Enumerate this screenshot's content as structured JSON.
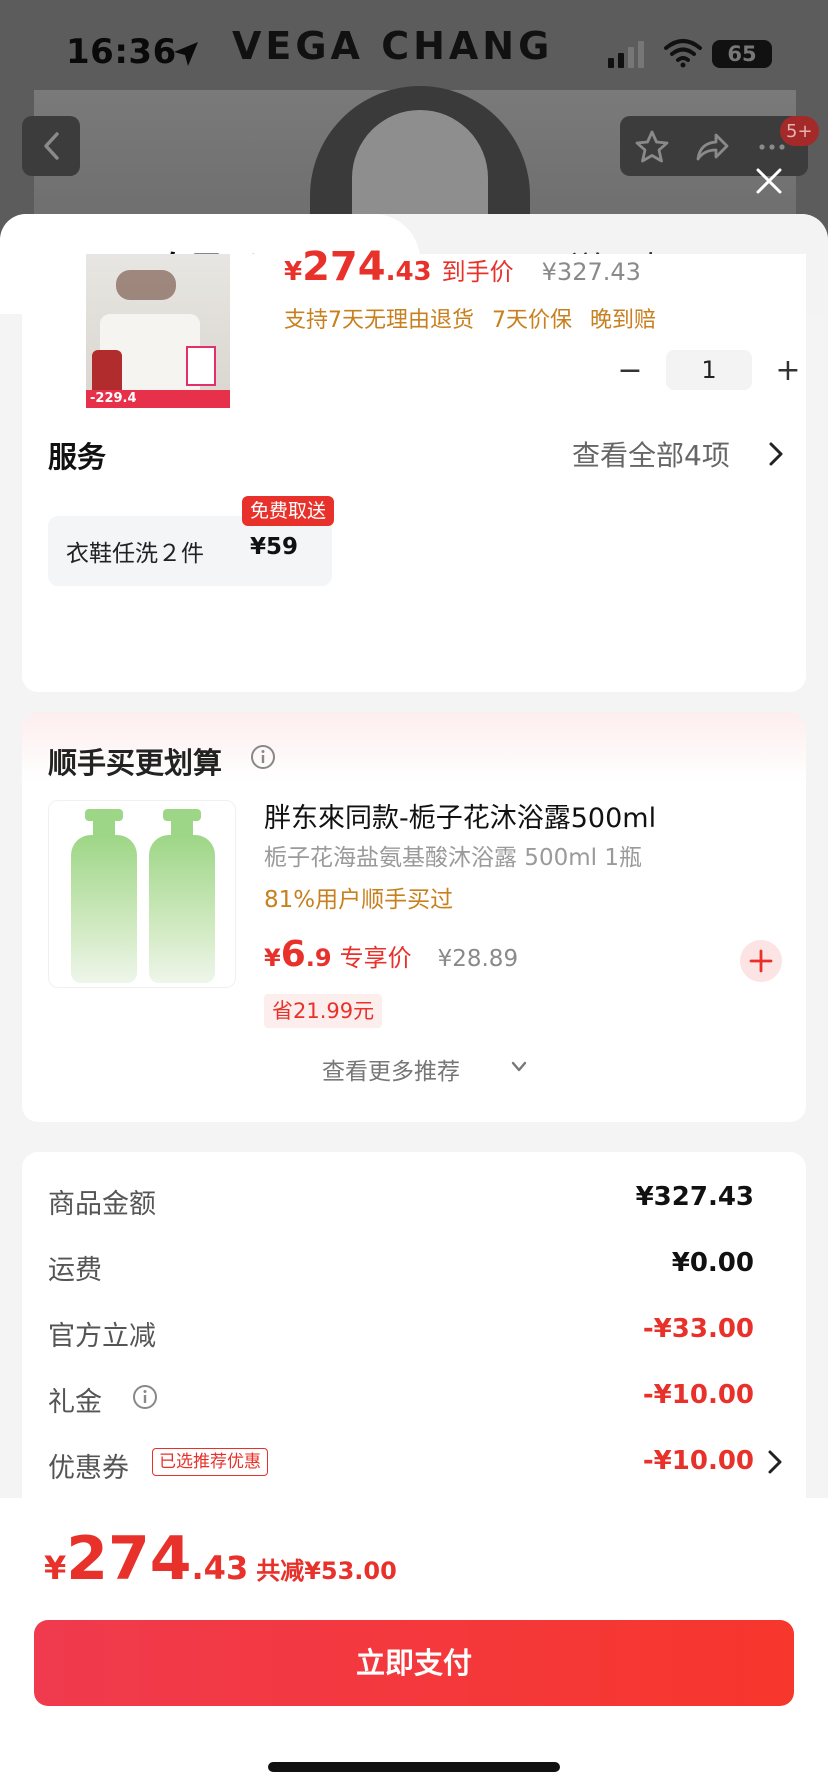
{
  "status_bar": {
    "time": "16:36",
    "carrier": "VEGA CHANG",
    "battery": "65"
  },
  "header": {
    "message_badge": "5+"
  },
  "tabs": [
    {
      "label": "自己买",
      "active": true
    },
    {
      "label": "送朋友",
      "active": false
    }
  ],
  "product": {
    "price_currency": "¥",
    "price_integer": "274",
    "price_decimal": ".43",
    "price_tag": "到手价",
    "original_price": "¥327.43",
    "guarantees": [
      "支持7天无理由退货",
      "7天价保",
      "晚到赔"
    ],
    "image_price_label": "-229.4",
    "quantity": "1"
  },
  "service": {
    "title": "服务",
    "view_all": "查看全部4项",
    "item_name": "衣鞋任洗２件",
    "item_price": "¥59",
    "item_badge": "免费取送"
  },
  "addon": {
    "title": "顺手买更划算",
    "name": "胖东來同款-栀子花沐浴露500ml",
    "spec": "栀子花海盐氨基酸沐浴露 500ml 1瓶",
    "social_proof": "81%用户顺手买过",
    "price_currency": "¥",
    "price_integer": "6",
    "price_decimal": ".9",
    "price_tag": "专享价",
    "original_price": "¥28.89",
    "save_label": "省21.99元",
    "more_label": "查看更多推荐"
  },
  "summary": {
    "rows": [
      {
        "label": "商品金额",
        "value": "¥327.43"
      },
      {
        "label": "运费",
        "value": "¥0.00"
      },
      {
        "label": "官方立减",
        "value": "-¥33.00"
      },
      {
        "label": "礼金",
        "value": "-¥10.00"
      },
      {
        "label": "优惠券",
        "value": "-¥10.00"
      }
    ],
    "coupon_tag": "已选推荐优惠"
  },
  "footer": {
    "total_currency": "¥",
    "total_integer": "274",
    "total_decimal": ".43",
    "total_saved": "共减¥53.00",
    "pay_button": "立即支付"
  },
  "colors": {
    "accent_red": "#e8312a",
    "guarantee_orange": "#c8801f"
  }
}
